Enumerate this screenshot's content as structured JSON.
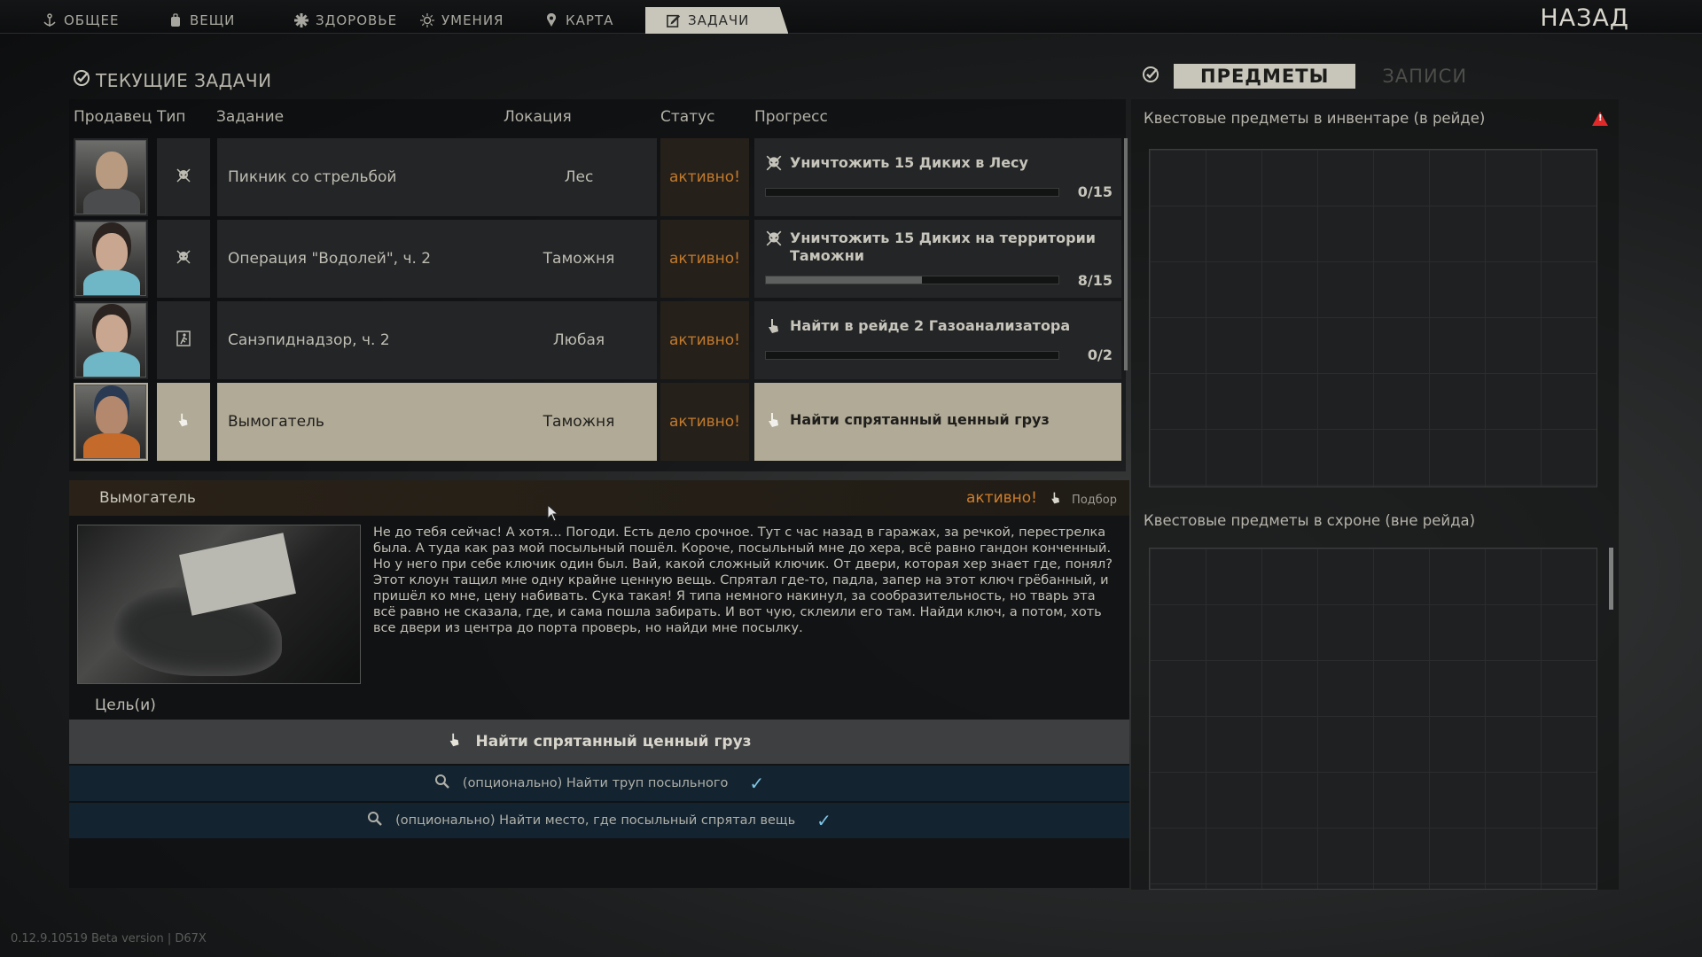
{
  "nav": {
    "tabs": [
      {
        "label": "ОБЩЕЕ",
        "icon": "anchor-icon"
      },
      {
        "label": "ВЕЩИ",
        "icon": "backpack-icon"
      },
      {
        "label": "ЗДОРОВЬЕ",
        "icon": "health-icon"
      },
      {
        "label": "УМЕНИЯ",
        "icon": "skills-icon"
      },
      {
        "label": "КАРТА",
        "icon": "map-pin-icon"
      },
      {
        "label": "ЗАДАЧИ",
        "icon": "tasks-icon"
      }
    ],
    "active_tab": "ЗАДАЧИ",
    "back_label": "НАЗАД"
  },
  "section": {
    "title": "ТЕКУЩИЕ ЗАДАЧИ"
  },
  "right_tabs": {
    "items_label": "ПРЕДМЕТЫ",
    "notes_label": "ЗАПИСИ"
  },
  "table": {
    "headers": {
      "trader": "Продавец",
      "type": "Тип",
      "task": "Задание",
      "location": "Локация",
      "status": "Статус",
      "progress": "Прогресс"
    },
    "rows": [
      {
        "type_icon": "skull-icon",
        "name": "Пикник со стрельбой",
        "location": "Лес",
        "status": "активно!",
        "objective_icon": "skull-icon",
        "objective": "Уничтожить 15 Диких в Лесу",
        "count": "0/15",
        "progress": 0
      },
      {
        "type_icon": "skull-icon",
        "name": "Операция \"Водолей\", ч. 2",
        "location": "Таможня",
        "status": "активно!",
        "objective_icon": "skull-icon",
        "objective": "Уничтожить 15 Диких на территории Таможни",
        "count": "8/15",
        "progress": 0.533
      },
      {
        "type_icon": "exit-icon",
        "name": "Санэпиднадзор, ч. 2",
        "location": "Любая",
        "status": "активно!",
        "objective_icon": "hand-icon",
        "objective": "Найти в рейде 2 Газоанализатора",
        "count": "0/2",
        "progress": 0
      },
      {
        "type_icon": "hand-icon",
        "name": "Вымогатель",
        "location": "Таможня",
        "status": "активно!",
        "objective_icon": "hand-icon",
        "objective": "Найти спрятанный ценный груз",
        "count": "",
        "progress": null,
        "selected": true
      }
    ]
  },
  "detail": {
    "title": "Вымогатель",
    "status": "активно!",
    "type": "Подбор",
    "description": "Не до тебя сейчас! А хотя... Погоди. Есть дело срочное. Тут с час назад в гаражах, за речкой, перестрелка была. А туда как раз мой посыльный пошёл. Короче, посыльный мне до хера, всё равно гандон конченный. Но у него при себе ключик один был. Вай, какой сложный ключик. От двери, которая хер знает где, понял? Этот клоун тащил мне одну крайне ценную вещь. Спрятал где-то, падла, запер на этот ключ грёбанный, и пришёл ко мне, цену набивать. Сука такая! Я типа немного накинул, за сообразительность, но тварь эта всё равно не сказала, где, и сама пошла забирать. И вот чую, склеили его там. Найди ключ, а потом, хоть все двери из центра до порта проверь, но найди мне посылку.",
    "goals_label": "Цель(и)",
    "main_objective": "Найти спрятанный ценный груз",
    "sub_objectives": [
      "(опционально) Найти труп посыльного",
      "(опционально) Найти место, где посыльный спрятал вещь"
    ]
  },
  "right": {
    "inventory_title": "Квестовые предметы в инвентаре (в рейде)",
    "stash_title": "Квестовые предметы в схроне (вне рейда)"
  },
  "version": "0.12.9.10519 Beta version | D67X",
  "colors": {
    "accent": "#c8c6bb",
    "active_status": "#c27a2c",
    "optional_check": "#7fc6e6",
    "warning": "#e02a2a"
  }
}
